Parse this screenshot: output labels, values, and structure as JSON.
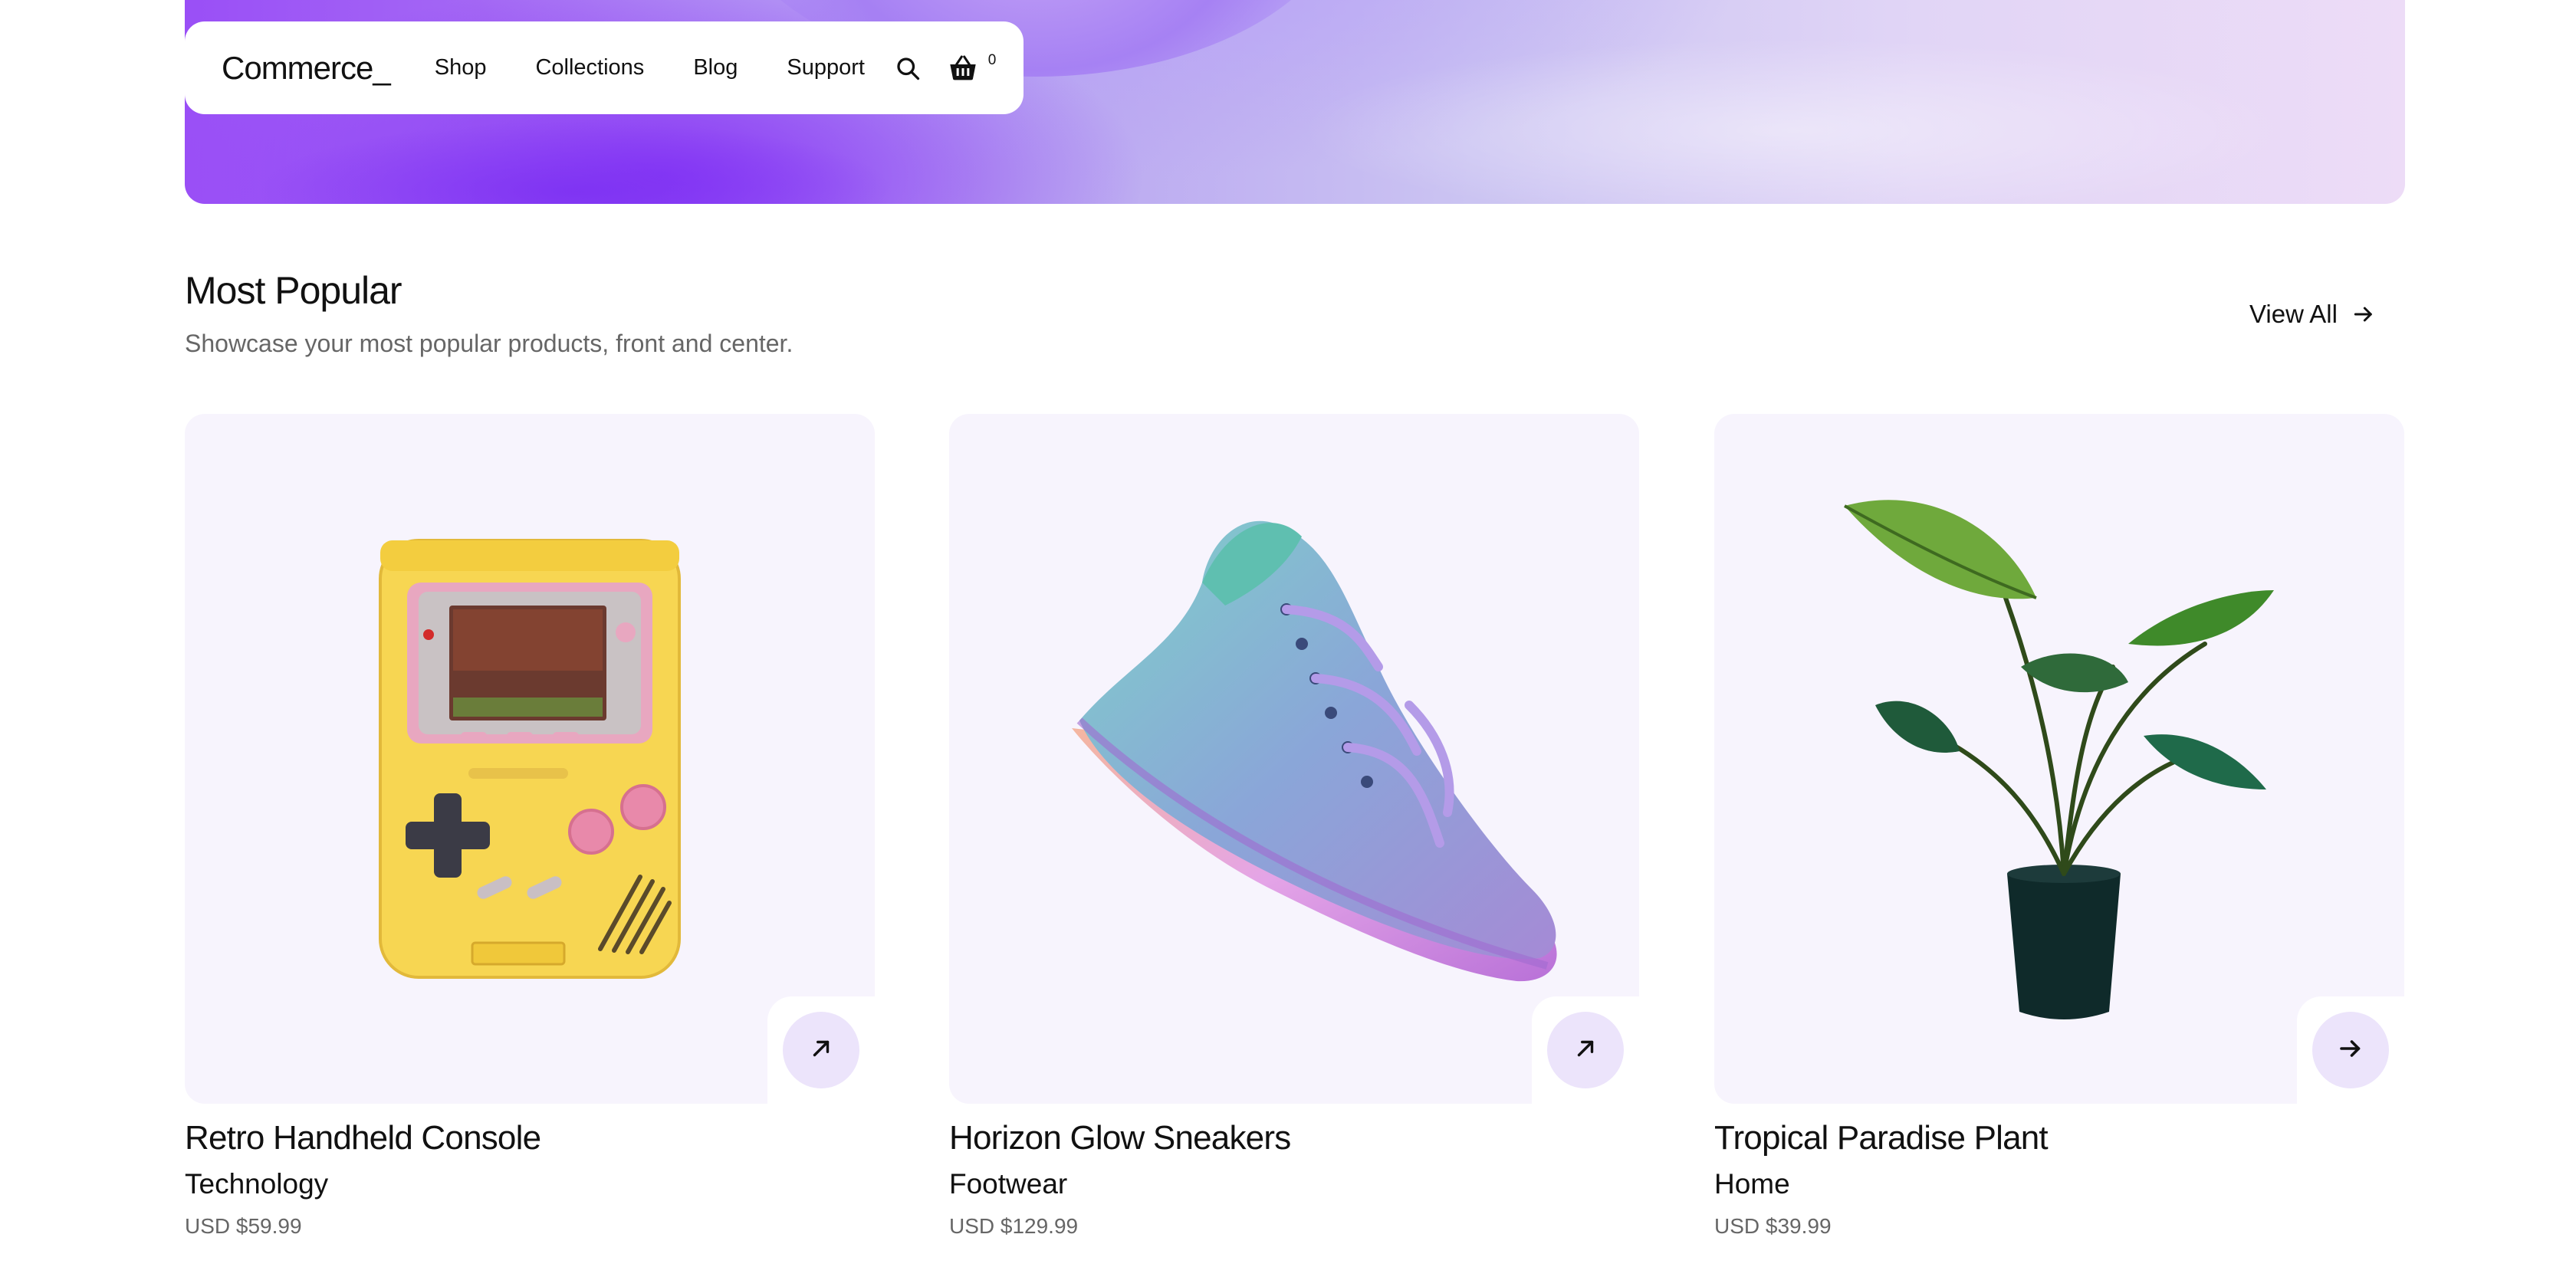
{
  "nav": {
    "logo": "Commerce_",
    "links": [
      "Shop",
      "Collections",
      "Blog",
      "Support"
    ],
    "cart_count": "0"
  },
  "section": {
    "title": "Most Popular",
    "subtitle": "Showcase your most popular products, front and center.",
    "view_all": "View All"
  },
  "products": [
    {
      "name": "Retro Handheld Console",
      "category": "Technology",
      "price": "USD $59.99",
      "icon": "arrow-up-right-icon"
    },
    {
      "name": "Horizon Glow Sneakers",
      "category": "Footwear",
      "price": "USD $129.99",
      "icon": "arrow-up-right-icon"
    },
    {
      "name": "Tropical Paradise Plant",
      "category": "Home",
      "price": "USD $39.99",
      "icon": "arrow-right-icon"
    }
  ],
  "colors": {
    "card_bg": "#f7f4fd",
    "button_bg": "#ece4fb",
    "hero_start": "#9a4ff6",
    "hero_end": "#eddcf7"
  }
}
